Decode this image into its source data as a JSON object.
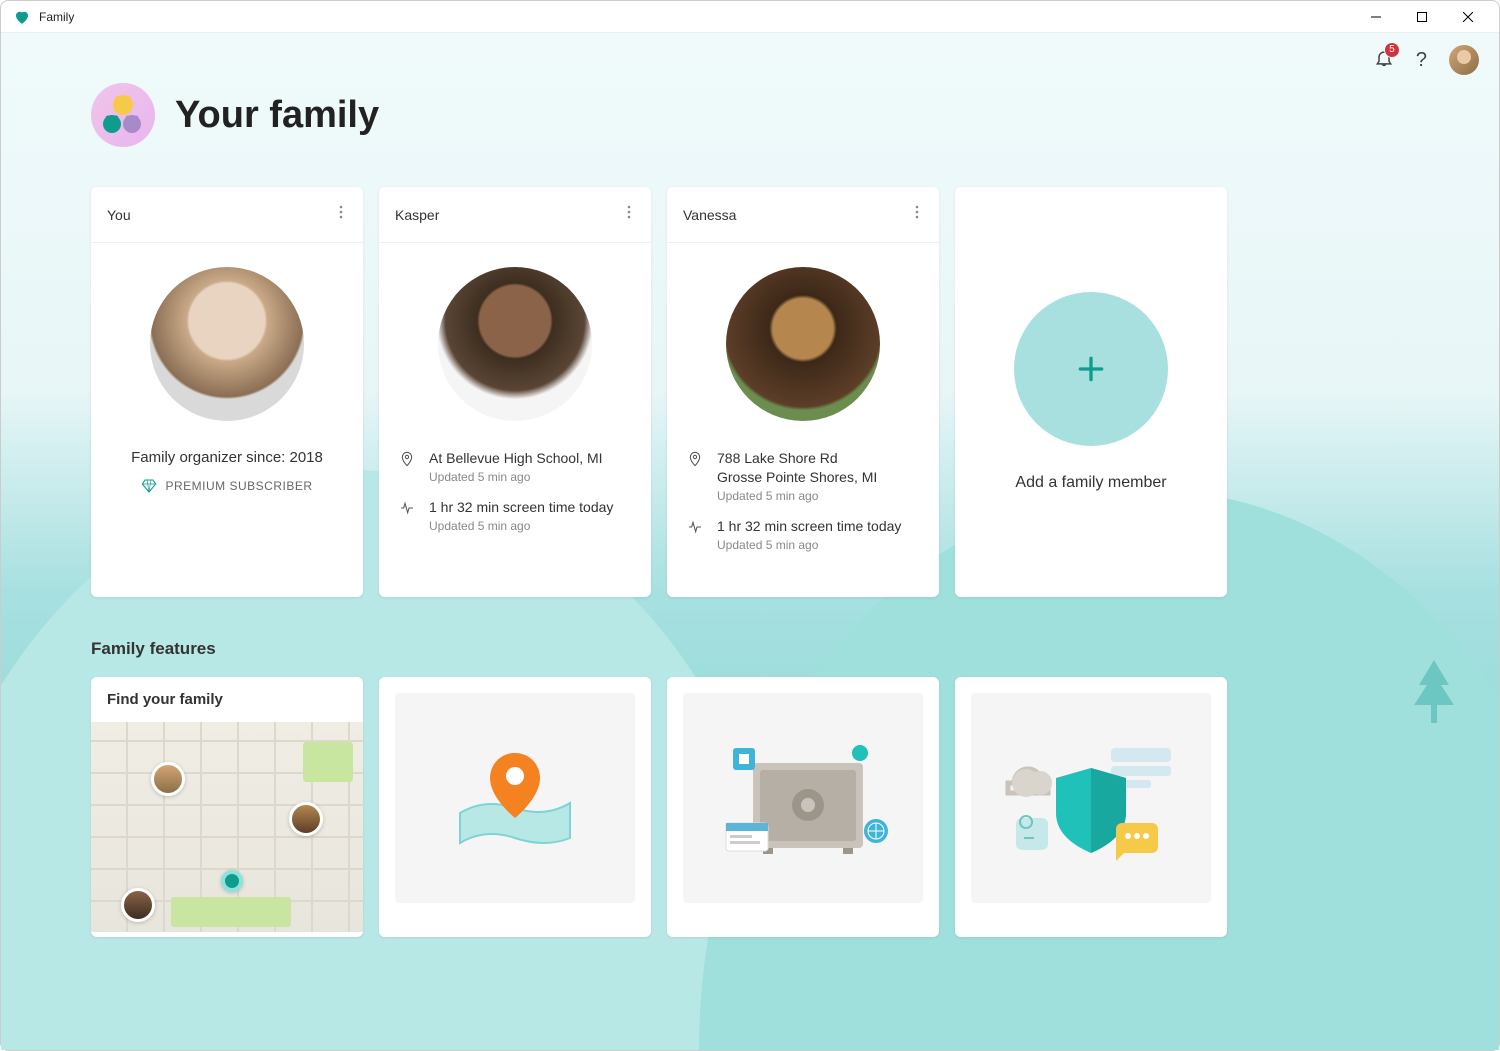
{
  "window": {
    "title": "Family"
  },
  "topbar": {
    "notif_count": "5"
  },
  "header": {
    "title": "Your family"
  },
  "members": [
    {
      "name": "You",
      "organizer_line": "Family organizer since: 2018",
      "premium_label": "PREMIUM SUBSCRIBER"
    },
    {
      "name": "Kasper",
      "location_line": "At Bellevue High School, MI",
      "location_updated": "Updated 5 min ago",
      "screen_line": "1 hr 32 min screen time today",
      "screen_updated": "Updated 5 min ago"
    },
    {
      "name": "Vanessa",
      "addr_line1": "788 Lake Shore Rd",
      "addr_line2": "Grosse Pointe Shores, MI",
      "location_updated": "Updated 5 min ago",
      "screen_line": "1 hr 32 min screen time today",
      "screen_updated": "Updated 5 min ago"
    }
  ],
  "add_member": {
    "label": "Add a family member"
  },
  "features": {
    "section_title": "Family features",
    "items": [
      {
        "title": "Find your family"
      }
    ]
  },
  "colors": {
    "accent": "#0d9c8e",
    "badge": "#d13438"
  }
}
